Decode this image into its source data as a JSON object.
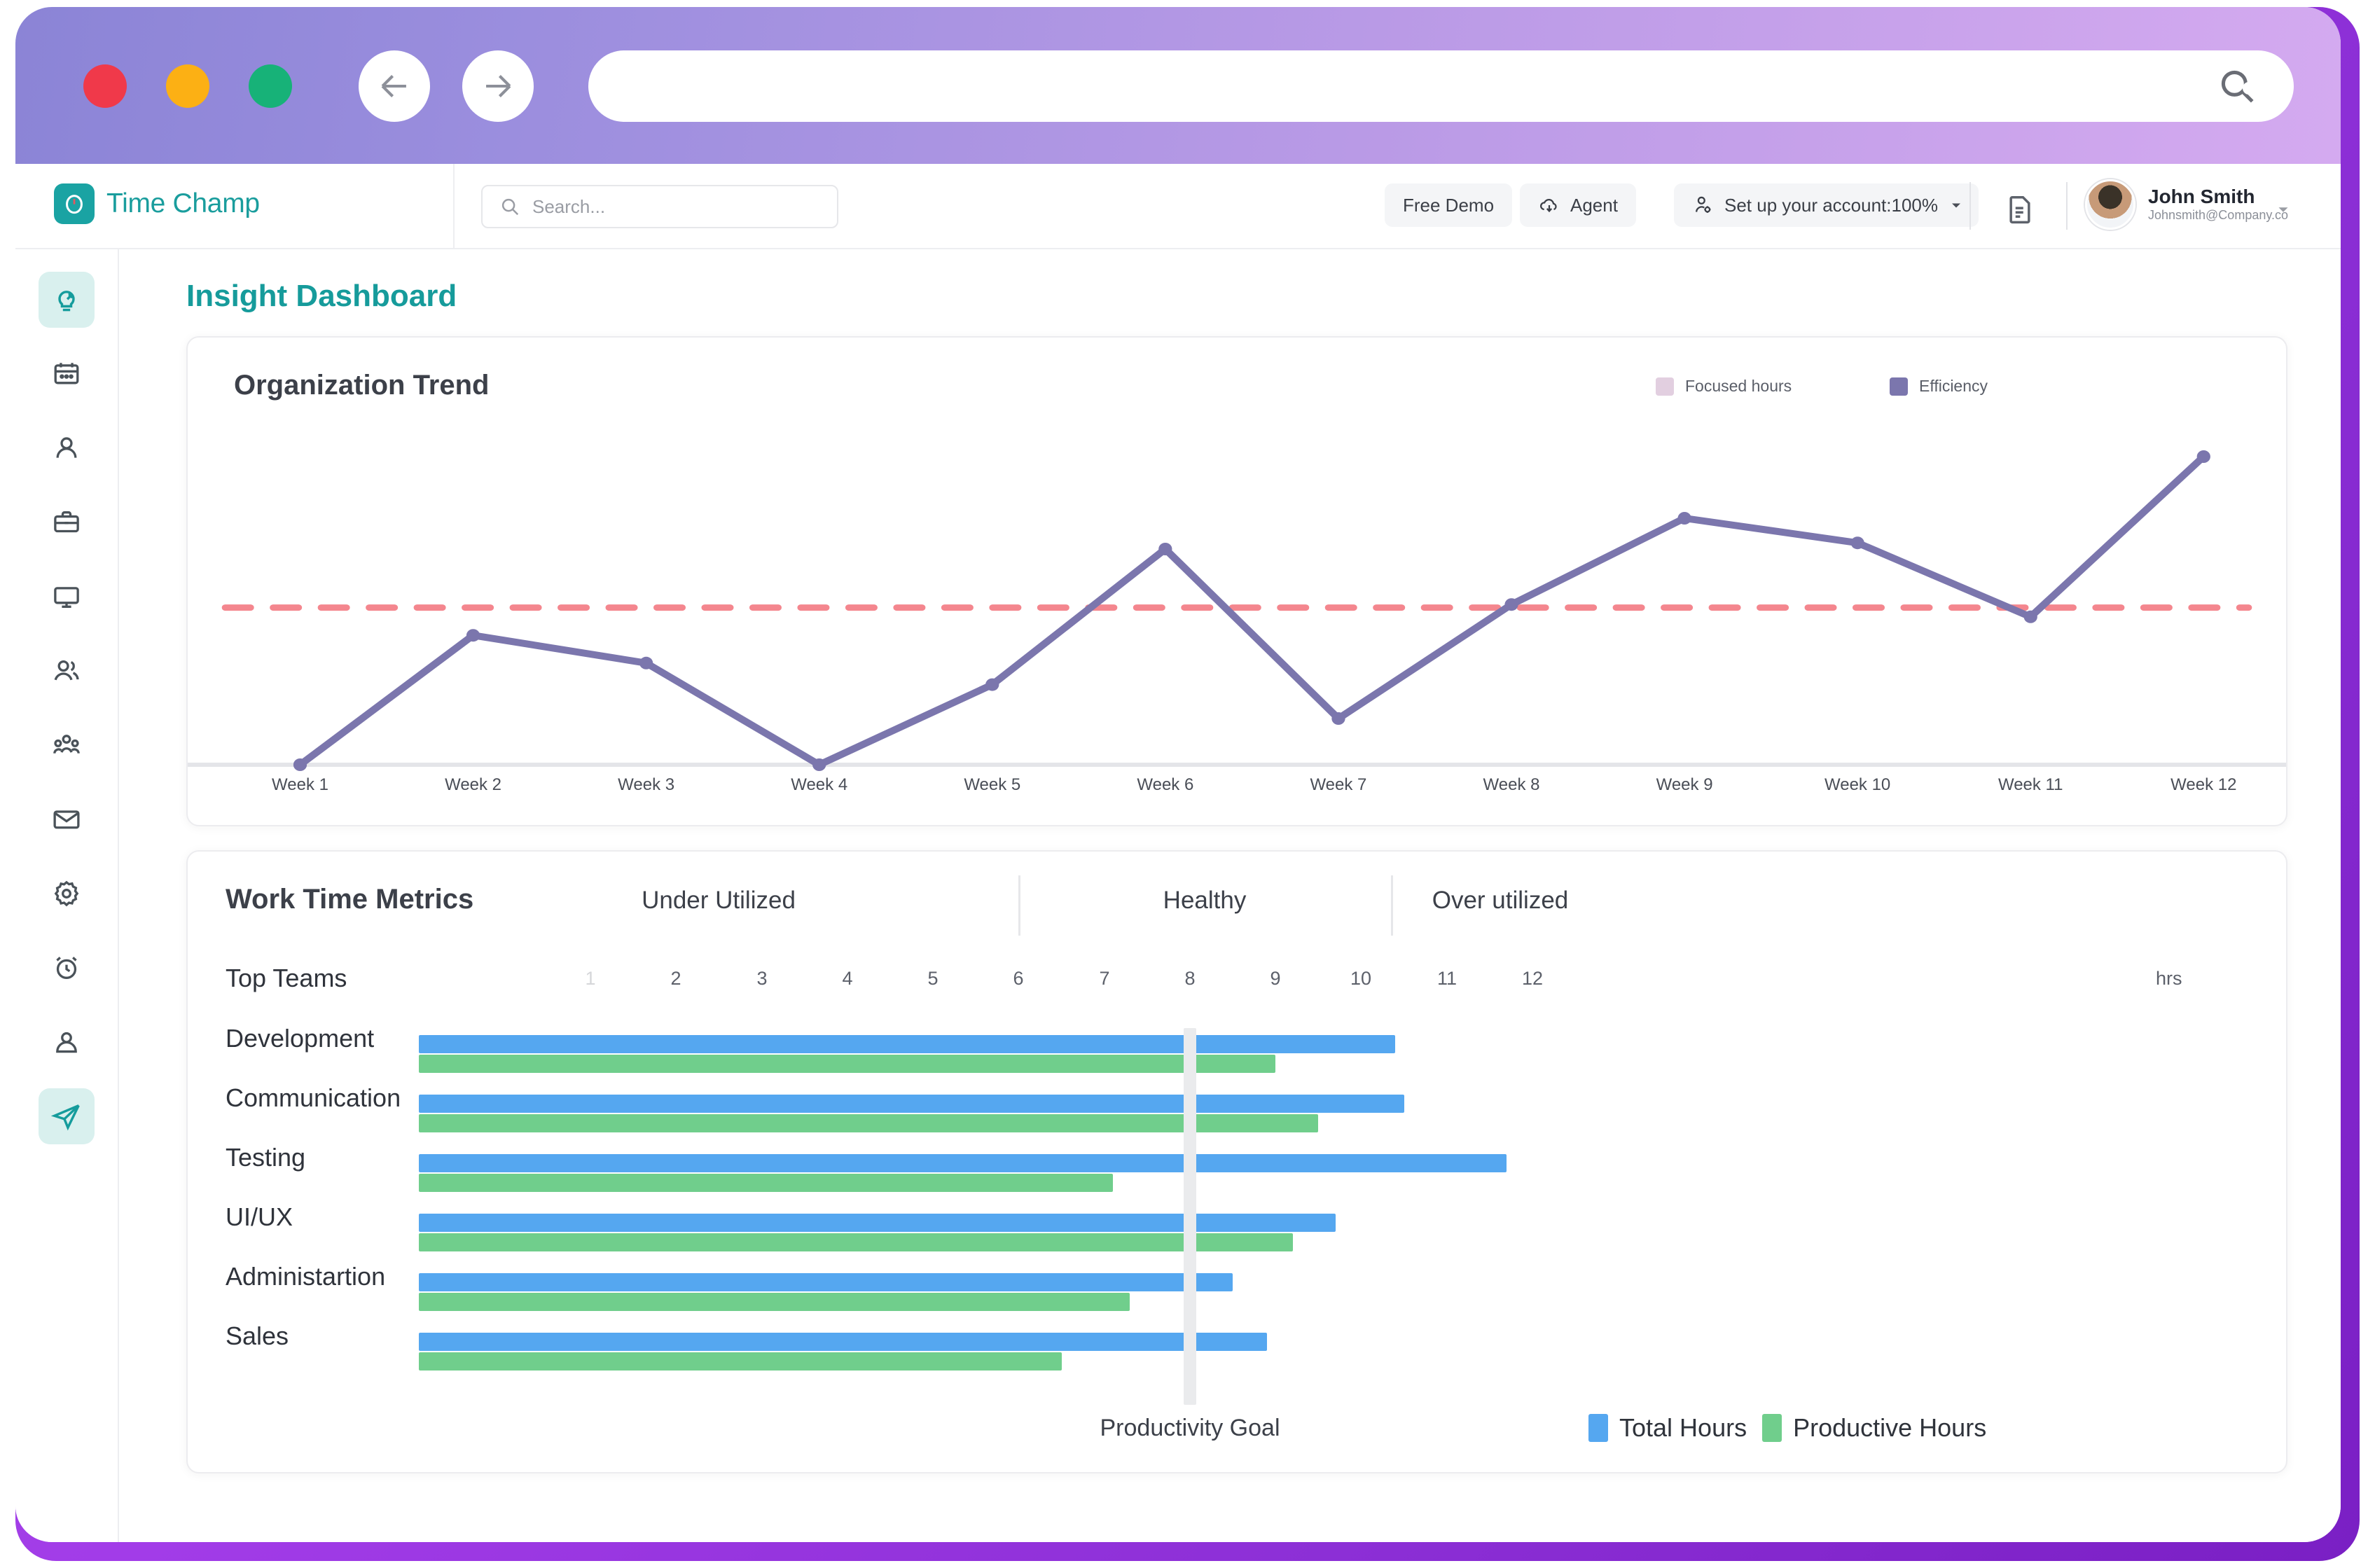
{
  "browser": {
    "traffic_lights": [
      "close",
      "minimize",
      "maximize"
    ],
    "back_icon": "arrow-left-icon",
    "forward_icon": "arrow-right-icon",
    "url_value": "",
    "url_search_icon": "search-icon",
    "menu_icon": "kebab-menu-icon"
  },
  "app_header": {
    "brand_name": "Time Champ",
    "brand_icon": "clock-logo-icon",
    "search": {
      "placeholder": "Search...",
      "value": "",
      "icon": "search-icon"
    },
    "free_demo_label": "Free Demo",
    "agent_label": "Agent",
    "agent_icon": "cloud-download-icon",
    "setup_label": "Set up your account:100%",
    "setup_icon": "user-gear-icon",
    "setup_caret": "chevron-down-icon",
    "doc_icon": "document-icon",
    "user": {
      "name": "John Smith",
      "email": "Johnsmith@Company.co",
      "avatar": "user-avatar",
      "caret": "chevron-down-icon"
    }
  },
  "sidebar": {
    "items": [
      {
        "name": "insights",
        "icon": "insight-bulb-icon",
        "active": true
      },
      {
        "name": "calendar",
        "icon": "calendar-icon",
        "active": false
      },
      {
        "name": "profile",
        "icon": "user-icon",
        "active": false
      },
      {
        "name": "projects",
        "icon": "briefcase-icon",
        "active": false
      },
      {
        "name": "screens",
        "icon": "monitor-icon",
        "active": false
      },
      {
        "name": "people",
        "icon": "users-icon",
        "active": false
      },
      {
        "name": "teams",
        "icon": "team-group-icon",
        "active": false
      },
      {
        "name": "mail",
        "icon": "envelope-icon",
        "active": false
      },
      {
        "name": "settings",
        "icon": "gear-icon",
        "active": false
      },
      {
        "name": "timers",
        "icon": "alarm-clock-icon",
        "active": false
      },
      {
        "name": "account",
        "icon": "user-circle-icon",
        "active": false
      },
      {
        "name": "send",
        "icon": "send-paper-plane-icon",
        "active": true
      }
    ]
  },
  "page": {
    "title": "Insight Dashboard"
  },
  "chart_data": [
    {
      "type": "line",
      "title": "Organization Trend",
      "xlabel": "",
      "ylabel": "",
      "grid": false,
      "legend_position": "top-right",
      "legend": [
        {
          "name": "Focused hours",
          "color": "#e2cfe0"
        },
        {
          "name": "Efficiency",
          "color": "#7b76ad"
        }
      ],
      "categories": [
        "Week 1",
        "Week 2",
        "Week 3",
        "Week 4",
        "Week 5",
        "Week 6",
        "Week 7",
        "Week 8",
        "Week 9",
        "Week 10",
        "Week 11",
        "Week 12"
      ],
      "series": [
        {
          "name": "Efficiency",
          "color": "#7b76ad",
          "values": [
            0,
            42,
            33,
            0,
            26,
            70,
            15,
            52,
            80,
            72,
            48,
            100
          ]
        }
      ],
      "threshold": {
        "label": "",
        "value": 51,
        "color": "#f4868e",
        "style": "dashed"
      },
      "ylim": [
        0,
        105
      ]
    },
    {
      "type": "bar",
      "orientation": "horizontal",
      "title": "Work Time Metrics",
      "row_header": "Top Teams",
      "unit_label": "hrs",
      "xlabel": "",
      "ylabel": "",
      "zones": [
        {
          "label": "Under Utilized",
          "range": [
            1,
            6
          ]
        },
        {
          "label": "Healthy",
          "range": [
            6,
            10
          ]
        },
        {
          "label": "Over utilized",
          "range": [
            10,
            12
          ]
        }
      ],
      "xticks": [
        1,
        2,
        3,
        4,
        5,
        6,
        7,
        8,
        9,
        10,
        11,
        12
      ],
      "xlim": [
        1,
        12
      ],
      "goal": {
        "label": "Productivity Goal",
        "value": 8
      },
      "categories": [
        "Development",
        "Communication",
        "Testing",
        "UI/UX",
        "Administartion",
        "Sales"
      ],
      "series": [
        {
          "name": "Total Hours",
          "color": "#55a7f0",
          "values": [
            10.4,
            10.5,
            11.7,
            9.7,
            8.5,
            8.9
          ]
        },
        {
          "name": "Productive Hours",
          "color": "#70ce8c",
          "values": [
            9.0,
            9.5,
            7.1,
            9.2,
            7.3,
            6.5
          ]
        }
      ],
      "legend_position": "bottom-right"
    }
  ]
}
